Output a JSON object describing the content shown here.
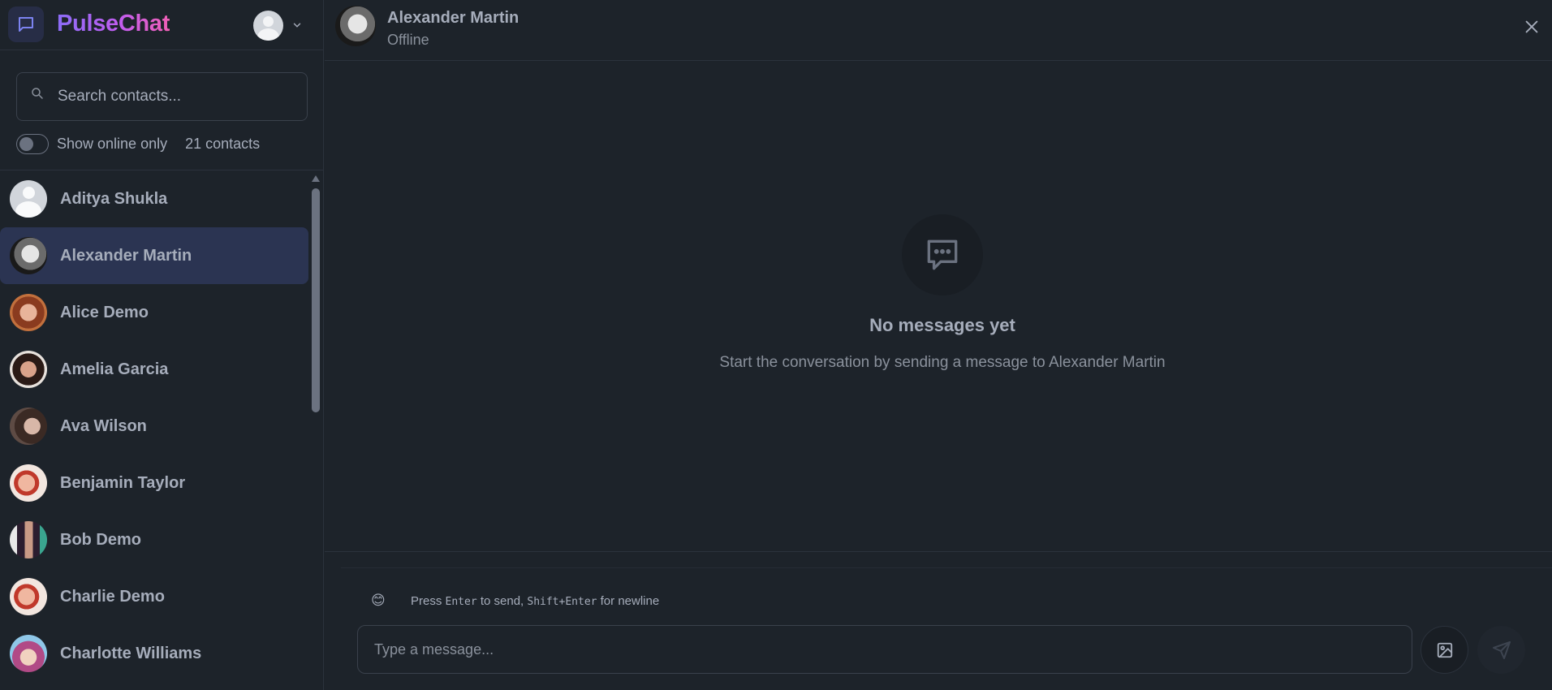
{
  "app": {
    "name": "PulseChat"
  },
  "sidebar": {
    "search_placeholder": "Search contacts...",
    "online_toggle_label": "Show online only",
    "online_only": false,
    "contact_count": "21 contacts",
    "contacts": [
      {
        "name": "Aditya Shukla",
        "active": false
      },
      {
        "name": "Alexander Martin",
        "active": true
      },
      {
        "name": "Alice Demo",
        "active": false
      },
      {
        "name": "Amelia Garcia",
        "active": false
      },
      {
        "name": "Ava Wilson",
        "active": false
      },
      {
        "name": "Benjamin Taylor",
        "active": false
      },
      {
        "name": "Bob Demo",
        "active": false
      },
      {
        "name": "Charlie Demo",
        "active": false
      },
      {
        "name": "Charlotte Williams",
        "active": false
      }
    ]
  },
  "chat": {
    "contact_name": "Alexander Martin",
    "contact_status": "Offline",
    "empty_title": "No messages yet",
    "empty_subtitle": "Start the conversation by sending a message to Alexander Martin",
    "hint": {
      "press": "Press",
      "key_send": "Enter",
      "to_send": "to send,",
      "key_newline": "Shift+Enter",
      "for_newline": "for newline"
    },
    "emoji": "😊",
    "input_placeholder": "Type a message..."
  }
}
